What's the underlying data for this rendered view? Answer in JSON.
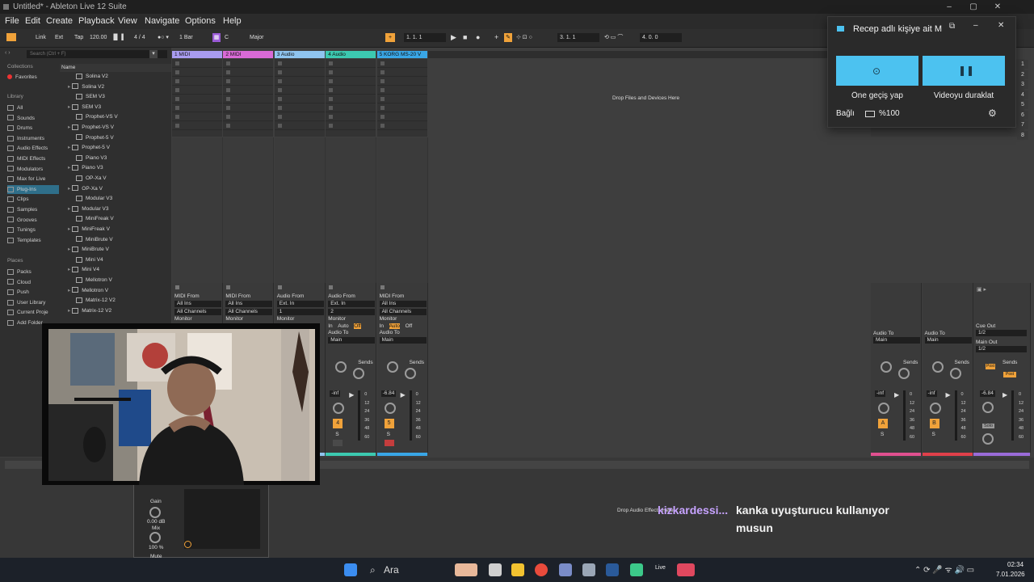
{
  "window": {
    "title": "Untitled* - Ableton Live 12 Suite"
  },
  "menu": [
    "File",
    "Edit",
    "Create",
    "Playback",
    "View",
    "Navigate",
    "Options",
    "Help"
  ],
  "control_bar": {
    "link": "Link",
    "ext": "Ext",
    "tap": "Tap",
    "tempo": "120.00",
    "signature": "4 / 4",
    "quantize": "1 Bar",
    "key": "C",
    "scale": "Major",
    "position": "1. 1. 1",
    "loop_start": "3. 1. 1",
    "loop_length": "4. 0. 0"
  },
  "browser": {
    "search_placeholder": "Search (Ctrl + F)",
    "collections_title": "Collections",
    "favorites": "Favorites",
    "library_title": "Library",
    "library_items": [
      "All",
      "Sounds",
      "Drums",
      "Instruments",
      "Audio Effects",
      "MIDI Effects",
      "Modulators",
      "Max for Live",
      "Plug-Ins",
      "Clips",
      "Samples",
      "Grooves",
      "Tunings",
      "Templates"
    ],
    "places_title": "Places",
    "places_items": [
      "Packs",
      "Cloud",
      "Push",
      "User Library",
      "Current Proje",
      "Add Folder"
    ],
    "name_header": "Name",
    "plugins": [
      "Solina V2",
      "Solina V2",
      "SEM V3",
      "SEM V3",
      "Prophet-VS V",
      "Prophet-VS V",
      "Prophet-5 V",
      "Prophet-5 V",
      "Piano V3",
      "Piano V3",
      "OP-Xa V",
      "OP-Xa V",
      "Modular V3",
      "Modular V3",
      "MiniFreak V",
      "MiniFreak V",
      "MiniBrute V",
      "MiniBrute V",
      "Mini V4",
      "Mini V4",
      "Mellotron V",
      "Mellotron V",
      "Matrix-12 V2",
      "Matrix-12 V2"
    ]
  },
  "tracks": [
    {
      "name": "1 MIDI",
      "color": "#a99cf0",
      "from_label": "MIDI From",
      "from": "All Ins",
      "channel": "All Channels",
      "monitor": "Monitor"
    },
    {
      "name": "2 MIDI",
      "color": "#d96ad6",
      "from_label": "MIDI From",
      "from": "All Ins",
      "channel": "All Channels",
      "monitor": "Monitor"
    },
    {
      "name": "3 Audio",
      "color": "#8fc4ef",
      "from_label": "Audio From",
      "from": "Ext. In",
      "channel": "1",
      "monitor": "Monitor"
    },
    {
      "name": "4 Audio",
      "color": "#3cc9b0",
      "from_label": "Audio From",
      "from": "Ext. In",
      "channel": "2",
      "monitor": "Monitor",
      "in": "In",
      "auto": "Auto",
      "off": "Off",
      "audio_to": "Audio To",
      "main": "Main",
      "sends": "Sends",
      "vol": "-inf",
      "num": "4",
      "solo": "S"
    },
    {
      "name": "5 KORG MS-20 V",
      "color": "#39a6e6",
      "from_label": "MIDI From",
      "from": "All Ins",
      "channel": "All Channels",
      "monitor": "Monitor",
      "in": "In",
      "auto": "Auto",
      "off": "Off",
      "audio_to": "Audio To",
      "main": "Main",
      "sends": "Sends",
      "vol": "-6.84",
      "num": "5",
      "solo": "S"
    }
  ],
  "returns": [
    {
      "audio_to": "Audio To",
      "main": "Main",
      "sends": "Sends",
      "vol": "-inf",
      "num": "A",
      "solo": "S",
      "color": "#e0508f"
    },
    {
      "audio_to": "Audio To",
      "main": "Main",
      "sends": "Sends",
      "vol": "-inf",
      "num": "B",
      "solo": "S",
      "color": "#e0404a"
    }
  ],
  "master": {
    "cue_out": "Cue Out",
    "cue_val": "1/2",
    "main_out": "Main Out",
    "main_val": "1/2",
    "sends": "Sends",
    "post": "Post",
    "vol": "-6.84",
    "solo": "Solo",
    "color": "#9a6bd8"
  },
  "meter_scale": [
    "0",
    "12",
    "24",
    "36",
    "48",
    "60"
  ],
  "scenes": [
    "1",
    "2",
    "3",
    "4",
    "5",
    "6",
    "7",
    "8"
  ],
  "drop_text": "Drop Files and Devices Here",
  "drop_effects": "Drop Audio Effects Here",
  "device": {
    "gain": "Gain",
    "gain_val": "0.00 dB",
    "mix": "Mix",
    "mix_val": "100 %",
    "mute": "Mute"
  },
  "popup": {
    "title": "Recep adlı kişiye ait M",
    "skip": "Öne geçiş yap",
    "pause": "Videoyu duraklat",
    "connected": "Bağlı",
    "battery": "%100"
  },
  "chat": {
    "user": "kizkardessi...",
    "message_line1": "kanka uyuşturucu kullanıyor",
    "message_line2": "musun"
  },
  "taskbar": {
    "search": "Ara",
    "live": "Live",
    "time": "02:34",
    "date": "7.01.2026"
  }
}
